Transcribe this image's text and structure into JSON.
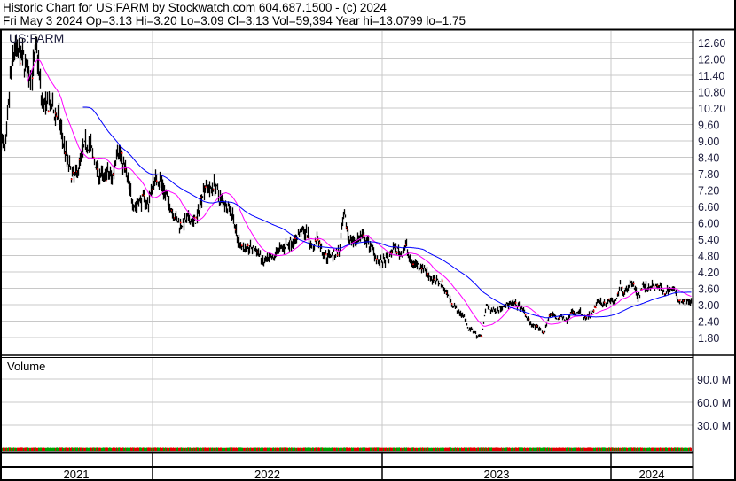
{
  "header": {
    "line1": "Historic Chart for US:FARM by Stockwatch.com 604.687.1500 - (c) 2024",
    "line2": "Fri May  3 2024  Op=3.13  Hi=3.20  Lo=3.09  Cl=3.13  Vol=59,394  Year hi=13.0799  lo=1.75"
  },
  "chart_data": {
    "type": "line",
    "title": "US:FARM",
    "symbol_label": "US:FARM",
    "volume_label": "Volume",
    "x_unit": "week",
    "period_labels": [
      "2021",
      "2022",
      "2023",
      "2024"
    ],
    "price_ylim": [
      1.2,
      13.2
    ],
    "price_ticks": [
      "12.60",
      "12.00",
      "11.40",
      "10.80",
      "10.20",
      "9.60",
      "9.00",
      "8.40",
      "7.80",
      "7.20",
      "6.60",
      "6.00",
      "5.40",
      "4.80",
      "4.20",
      "3.60",
      "3.00",
      "2.40",
      "1.80"
    ],
    "volume_ticks": [
      "90.0 M",
      "60.0 M",
      "30.0 M"
    ],
    "volume_tick_values_m": [
      90,
      60,
      30
    ],
    "moving_average_periods": [
      30,
      93
    ],
    "colors": {
      "price": "#000000",
      "close_tick": "#ff0000",
      "ma_short": "#ff00ff",
      "ma_long": "#0000ff",
      "volume": "#00a000",
      "volume_down": "#e00000"
    },
    "weekly_close": [
      9.0,
      8.74,
      11.2,
      12.4,
      12.1,
      12.0,
      11.4,
      11.5,
      12.5,
      10.56,
      10.2,
      10.36,
      10.0,
      9.8,
      8.9,
      8.2,
      7.64,
      7.8,
      8.5,
      8.9,
      8.84,
      8.2,
      7.8,
      7.64,
      7.8,
      7.64,
      8.74,
      8.4,
      7.86,
      7.1,
      6.57,
      6.8,
      6.9,
      6.66,
      7.44,
      7.64,
      7.44,
      6.99,
      6.57,
      6.24,
      5.92,
      6.0,
      6.14,
      6.0,
      6.14,
      6.99,
      7.44,
      7.2,
      7.44,
      6.9,
      6.8,
      6.57,
      6.34,
      5.4,
      5.17,
      5.0,
      5.1,
      5.0,
      4.85,
      4.52,
      4.65,
      4.65,
      4.98,
      5.08,
      5.17,
      5.3,
      5.3,
      5.63,
      5.72,
      5.5,
      4.98,
      5.5,
      4.98,
      4.75,
      4.85,
      4.85,
      4.98,
      6.3,
      5.5,
      5.3,
      5.4,
      5.5,
      5.3,
      5.17,
      4.85,
      4.52,
      4.6,
      4.65,
      5.08,
      4.98,
      4.85,
      5.17,
      4.52,
      4.52,
      4.43,
      4.33,
      4.1,
      3.88,
      3.88,
      3.78,
      3.45,
      3.13,
      2.9,
      2.7,
      2.58,
      2.1,
      2.05,
      1.83,
      1.9,
      3.0,
      2.78,
      2.8,
      2.85,
      3.0,
      3.0,
      3.03,
      2.97,
      2.85,
      2.55,
      2.3,
      2.18,
      2.12,
      1.95,
      2.58,
      2.64,
      2.48,
      2.55,
      2.42,
      2.75,
      2.64,
      2.75,
      2.48,
      2.58,
      2.7,
      3.19,
      3.07,
      3.07,
      3.19,
      3.03,
      3.68,
      3.45,
      3.71,
      3.84,
      3.23,
      3.68,
      3.62,
      3.68,
      3.62,
      3.68,
      3.39,
      3.62,
      3.55,
      3.23,
      3.13,
      3.13,
      3.13
    ],
    "volume_spike": {
      "week_index": 108,
      "value_m": 114
    },
    "volume_typical_m": 0.5,
    "volume_max_m": 122
  }
}
